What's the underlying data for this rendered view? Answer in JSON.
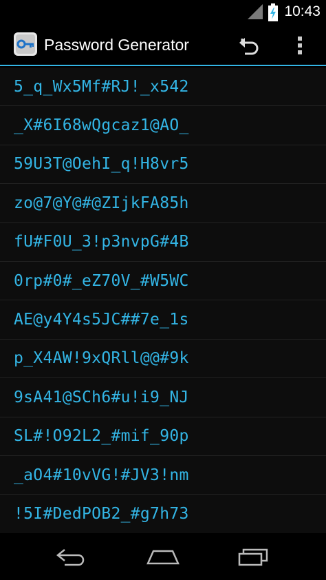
{
  "status_bar": {
    "time": "10:43",
    "icons": [
      "cell-signal-icon",
      "battery-charging-icon"
    ]
  },
  "action_bar": {
    "title": "Password Generator",
    "app_icon": "key-icon",
    "actions": [
      "undo-icon",
      "overflow-menu-icon"
    ]
  },
  "passwords": [
    "5_q_Wx5Mf#RJ!_x542",
    "_X#6I68wQgcaz1@AO_",
    "59U3T@OehI_q!H8vr5",
    "zo@7@Y@#@ZIjkFA85h",
    "fU#F0U_3!p3nvpG#4B",
    "0rp#0#_eZ70V_#W5WC",
    "AE@y4Y4s5JC##7e_1s",
    "p_X4AW!9xQRll@@#9k",
    "9sA41@SCh6#u!i9_NJ",
    "SL#!O92L2_#mif_90p",
    "_aO4#10vVG!#JV3!nm",
    "!5I#DedPOB2_#g7h73"
  ],
  "nav_bar": {
    "buttons": [
      "back-icon",
      "home-icon",
      "recents-icon"
    ]
  },
  "colors": {
    "accent": "#33b5e5",
    "background": "#000000"
  }
}
